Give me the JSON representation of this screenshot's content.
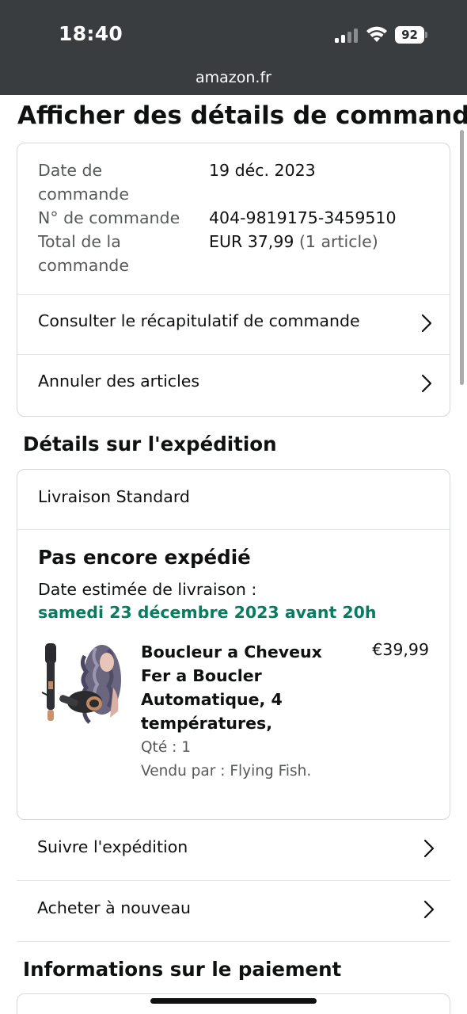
{
  "status_bar": {
    "time": "18:40",
    "battery": "92"
  },
  "url_bar": {
    "url": "amazon.fr"
  },
  "page": {
    "title": "Afficher des détails de commande"
  },
  "order_summary": {
    "order_date_label": "Date de commande",
    "order_date_value": "19 déc. 2023",
    "order_number_label": "N° de commande",
    "order_number_value": "404-9819175-3459510",
    "order_total_label": "Total de la commande",
    "order_total_value": "EUR 37,99",
    "order_total_items": "(1 article)",
    "links": [
      {
        "label": "Consulter le récapitulatif de commande"
      },
      {
        "label": "Annuler des articles"
      }
    ]
  },
  "shipping": {
    "section_title": "Détails sur l'expédition",
    "method": "Livraison Standard",
    "status": "Pas encore expédié",
    "estimated_label": "Date estimée de livraison :",
    "estimated_date": "samedi 23 décembre 2023 avant 20h",
    "product": {
      "title": "Boucleur a Cheveux Fer a Boucler Automatique, 4 températures,",
      "price": "€39,99",
      "quantity": "Qté : 1",
      "seller": "Vendu par : Flying Fish."
    },
    "actions": [
      {
        "label": "Suivre l'expédition"
      },
      {
        "label": "Acheter à nouveau"
      }
    ]
  },
  "payment": {
    "section_title": "Informations sur le paiement"
  },
  "colors": {
    "status_bar_bg": "#3a3d40",
    "delivery_green": "#067d62",
    "text_primary": "#0f1111",
    "text_secondary": "#565959",
    "border": "#d5d9d9"
  }
}
